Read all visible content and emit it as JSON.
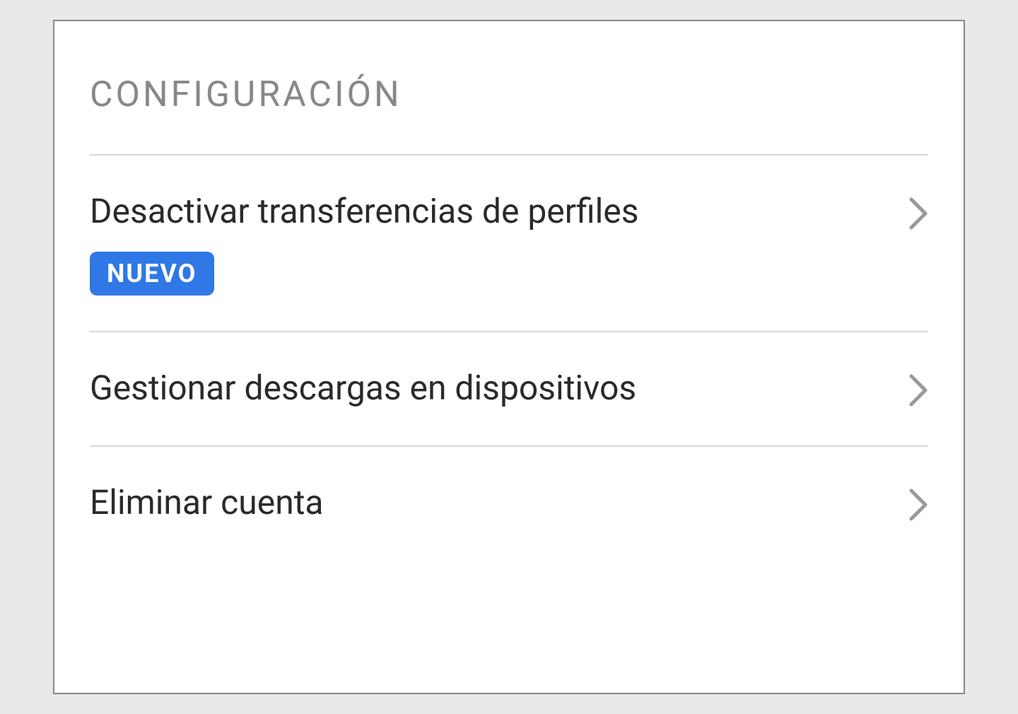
{
  "section": {
    "title": "CONFIGURACIÓN"
  },
  "items": [
    {
      "label": "Desactivar transferencias de perfiles",
      "badge": "NUEVO"
    },
    {
      "label": "Gestionar descargas en dispositivos"
    },
    {
      "label": "Eliminar cuenta"
    }
  ]
}
